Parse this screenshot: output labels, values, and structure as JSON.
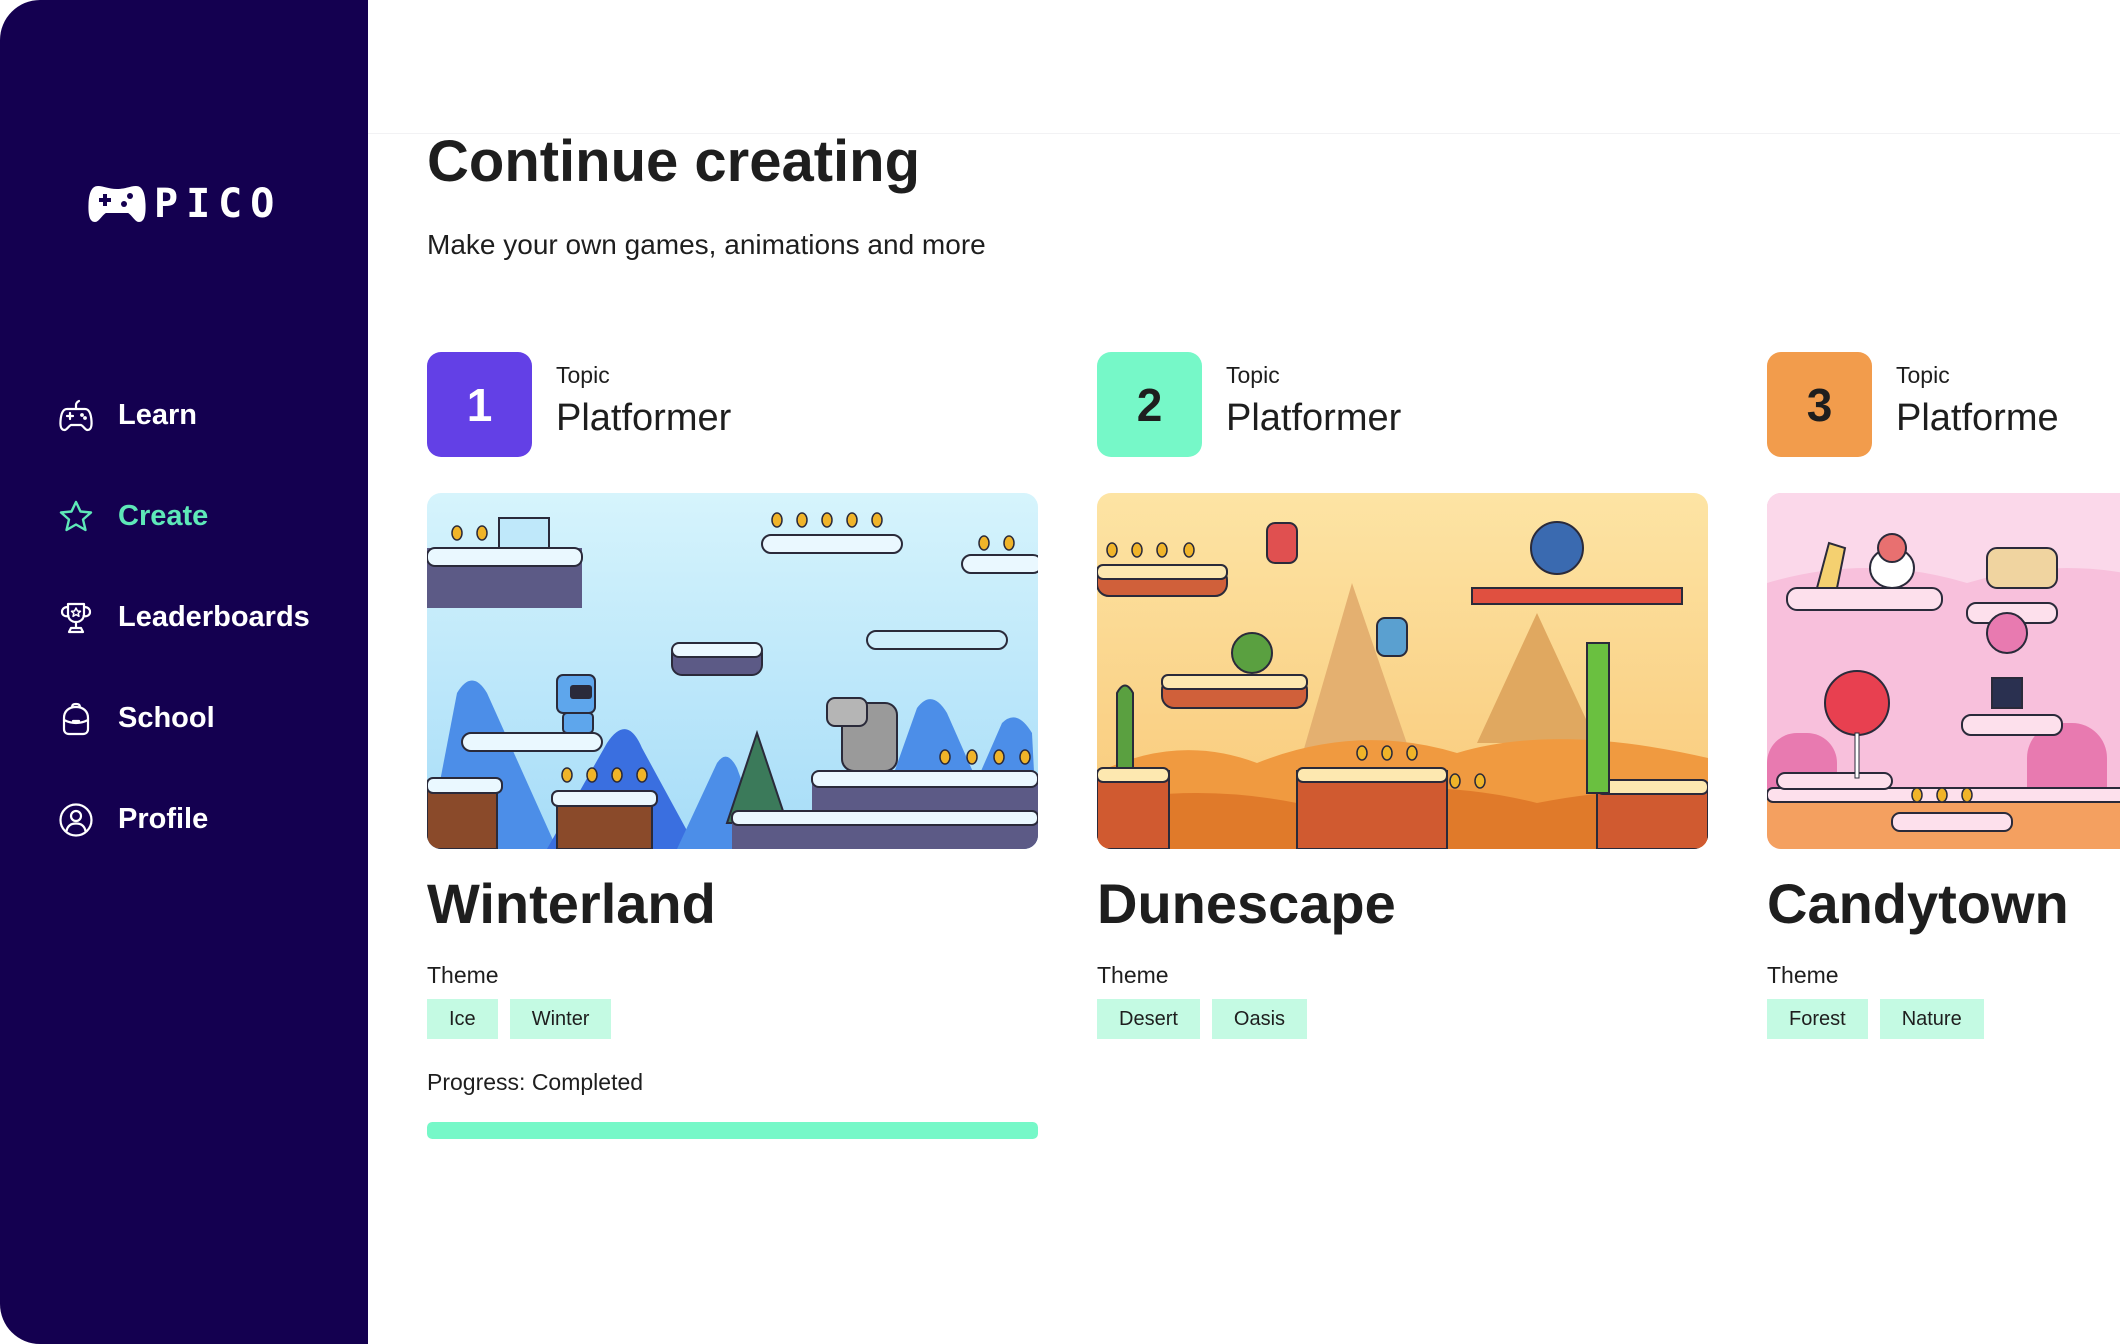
{
  "app": {
    "name": "PICO"
  },
  "sidebar": {
    "items": [
      {
        "label": "Learn",
        "icon": "gamepad-icon",
        "active": false
      },
      {
        "label": "Create",
        "icon": "star-icon",
        "active": true
      },
      {
        "label": "Leaderboards",
        "icon": "trophy-icon",
        "active": false
      },
      {
        "label": "School",
        "icon": "backpack-icon",
        "active": false
      },
      {
        "label": "Profile",
        "icon": "user-circle-icon",
        "active": false
      }
    ]
  },
  "main": {
    "title": "Continue creating",
    "subtitle": "Make your own games, animations and more",
    "cards": [
      {
        "number": "1",
        "number_color": "#6340e6",
        "number_text_color": "#ffffff",
        "topic_label": "Topic",
        "topic": "Platformer",
        "image": "winter-level-illustration",
        "title": "Winterland",
        "theme_label": "Theme",
        "tags": [
          "Ice",
          "Winter"
        ],
        "progress_label": "Progress: Completed",
        "progress": 1.0
      },
      {
        "number": "2",
        "number_color": "#76f8c8",
        "number_text_color": "#1e1e1e",
        "topic_label": "Topic",
        "topic": "Platformer",
        "image": "desert-level-illustration",
        "title": "Dunescape",
        "theme_label": "Theme",
        "tags": [
          "Desert",
          "Oasis"
        ]
      },
      {
        "number": "3",
        "number_color": "#f29c4c",
        "number_text_color": "#1e1e1e",
        "topic_label": "Topic",
        "topic": "Platforme",
        "image": "candy-level-illustration",
        "title": "Candytown",
        "theme_label": "Theme",
        "tags": [
          "Forest",
          "Nature"
        ]
      }
    ]
  },
  "colors": {
    "sidebar_bg": "#140050",
    "accent": "#5ee8b8",
    "tag_bg": "#c4fae3",
    "progress": "#76f8c8"
  }
}
